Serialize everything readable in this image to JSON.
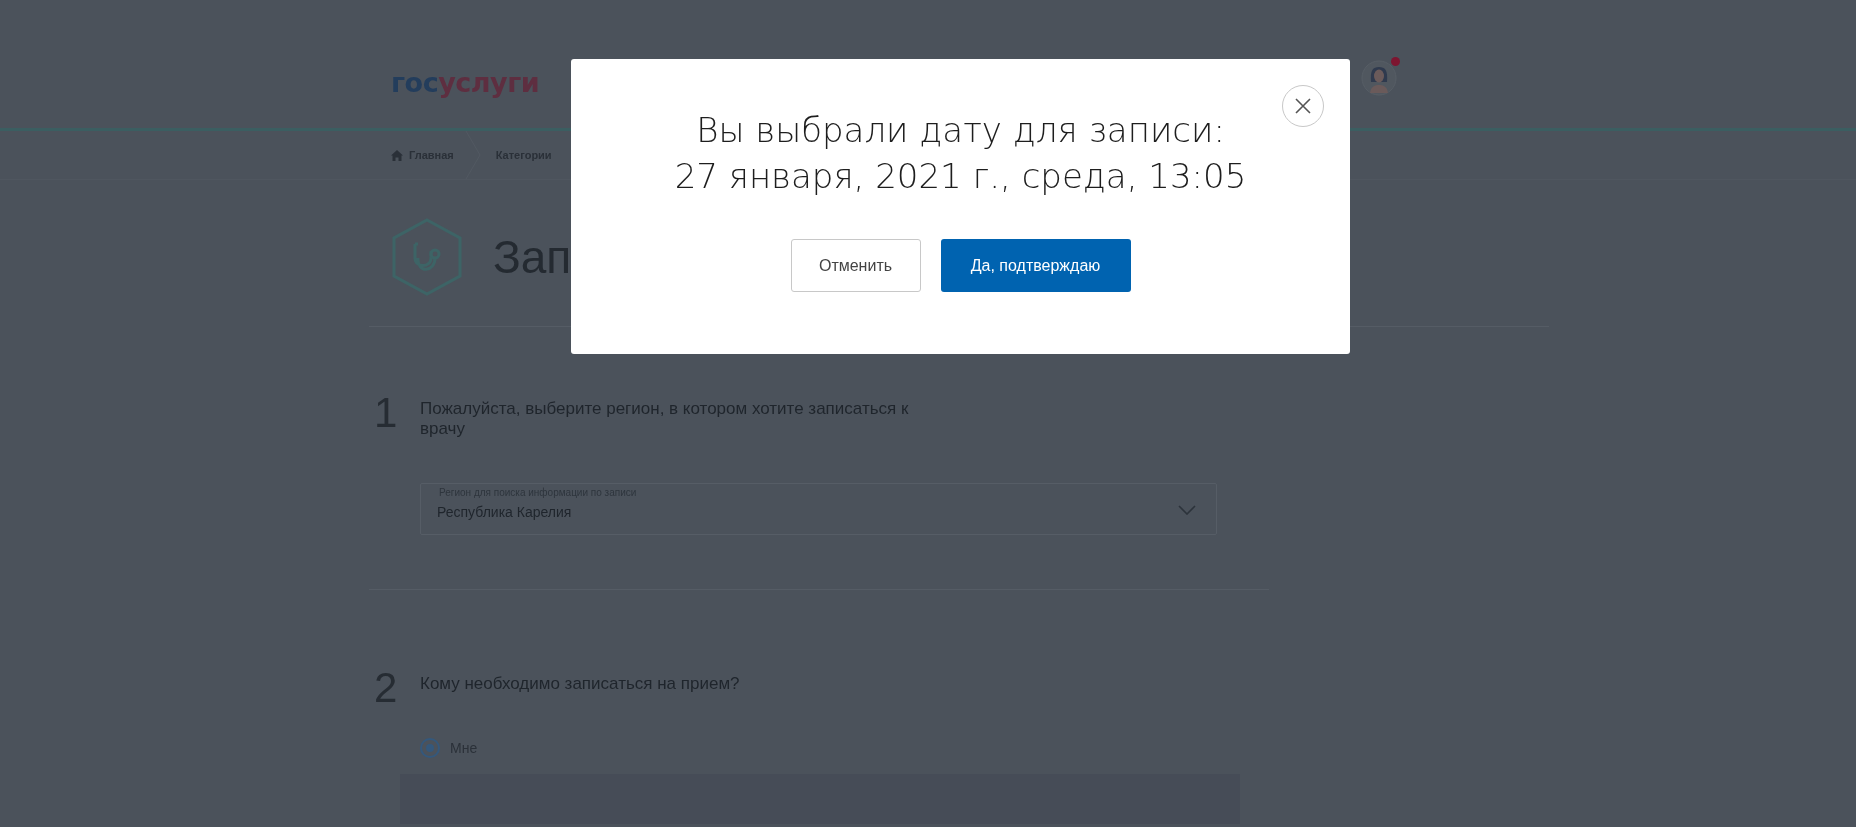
{
  "header": {
    "logo": {
      "first_part": "гос",
      "second_part": "услуги"
    },
    "avatar": {
      "notification": true
    }
  },
  "breadcrumbs": [
    {
      "label": "Главная",
      "kind": "home"
    },
    {
      "label": "Категории",
      "kind": "link"
    }
  ],
  "page_title": "Зап",
  "steps": [
    {
      "number": "1",
      "question": "Пожалуйста, выберите регион, в котором хотите записаться к врачу",
      "field": {
        "label": "Регион для поиска информации по записи",
        "value": "Республика Карелия"
      }
    },
    {
      "number": "2",
      "question": "Кому необходимо записаться на прием?",
      "options": [
        {
          "label": "Мне",
          "selected": true
        }
      ]
    }
  ],
  "modal": {
    "title_lines": [
      "Вы выбрали дату для записи:",
      "27 января, 2021 г., среда, 13:05"
    ],
    "buttons": [
      {
        "label": "Отменить",
        "kind": "secondary"
      },
      {
        "label": "Да, подтверждаю",
        "kind": "primary"
      }
    ]
  }
}
